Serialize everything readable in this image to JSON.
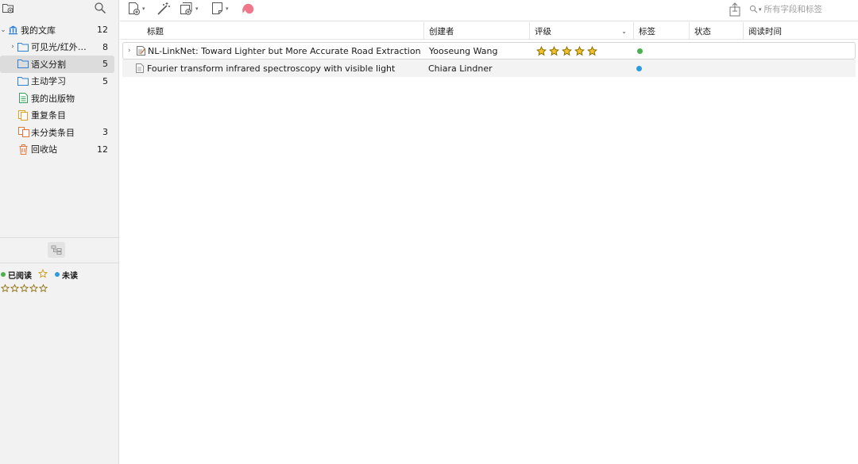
{
  "sidebar": {
    "tree": [
      {
        "label": "我的文库",
        "count": "12",
        "icon": "library-icon",
        "expanded": true
      },
      {
        "label": "可见光/红外融...",
        "count": "8",
        "icon": "folder-icon",
        "collapsed": true
      },
      {
        "label": "语义分割",
        "count": "5",
        "icon": "folder-icon",
        "selected": true
      },
      {
        "label": "主动学习",
        "count": "5",
        "icon": "folder-icon"
      },
      {
        "label": "我的出版物",
        "count": "",
        "icon": "publications-icon"
      },
      {
        "label": "重复条目",
        "count": "",
        "icon": "duplicates-icon"
      },
      {
        "label": "未分类条目",
        "count": "3",
        "icon": "unfiled-icon"
      },
      {
        "label": "回收站",
        "count": "12",
        "icon": "trash-icon"
      }
    ],
    "tags": [
      {
        "label": "已阅读",
        "color": "#4caf50"
      },
      {
        "label": "未读",
        "color": "#2e9be0"
      }
    ]
  },
  "toolbar": {
    "search_placeholder": "所有字段和标签"
  },
  "table": {
    "columns": [
      "标题",
      "创建者",
      "评级",
      "标签",
      "状态",
      "阅读时间"
    ],
    "rows": [
      {
        "title": "NL-LinkNet: Toward Lighter but More Accurate Road Extraction wit...",
        "creator": "Yooseung Wang",
        "rating": 5,
        "tag_color": "#4caf50",
        "type": "journal-article-icon",
        "expandable": true
      },
      {
        "title": "Fourier transform infrared spectroscopy with visible light",
        "creator": "Chiara Lindner",
        "rating": 0,
        "tag_color": "#2e9be0",
        "type": "document-icon",
        "expandable": false
      }
    ]
  },
  "colors": {
    "accent_pink": "#f0768a",
    "folder_blue": "#2e7fd6",
    "star_gold": "#f3c623"
  }
}
